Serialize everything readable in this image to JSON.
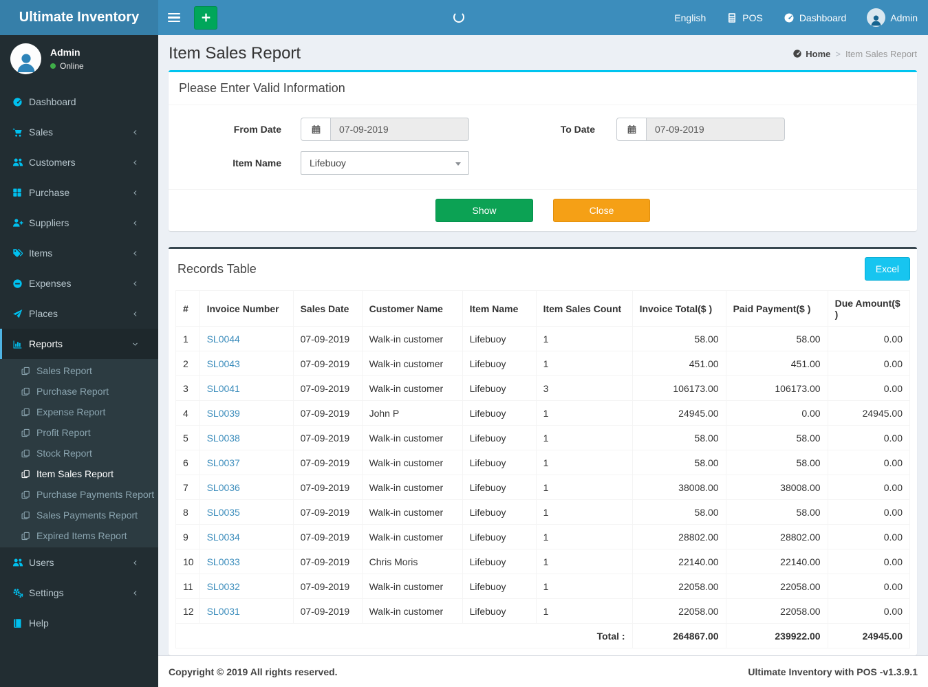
{
  "navbar": {
    "brand": "Ultimate Inventory",
    "language": "English",
    "pos_label": "POS",
    "dashboard_label": "Dashboard",
    "user_label": "Admin"
  },
  "sidebar": {
    "user": {
      "name": "Admin",
      "status": "Online"
    },
    "items": [
      {
        "label": "Dashboard",
        "icon": "speedometer-icon"
      },
      {
        "label": "Sales",
        "icon": "cart-icon"
      },
      {
        "label": "Customers",
        "icon": "users-icon"
      },
      {
        "label": "Purchase",
        "icon": "grid-icon"
      },
      {
        "label": "Suppliers",
        "icon": "user-plus-icon"
      },
      {
        "label": "Items",
        "icon": "tags-icon"
      },
      {
        "label": "Expenses",
        "icon": "minus-circle-icon"
      },
      {
        "label": "Places",
        "icon": "paper-plane-icon"
      },
      {
        "label": "Reports",
        "icon": "bar-chart-icon",
        "active": true,
        "expanded": true
      },
      {
        "label": "Users",
        "icon": "users-icon"
      },
      {
        "label": "Settings",
        "icon": "gears-icon"
      },
      {
        "label": "Help",
        "icon": "book-icon"
      }
    ],
    "reports_submenu": [
      {
        "label": "Sales Report",
        "icon": "copy-icon"
      },
      {
        "label": "Purchase Report",
        "icon": "copy-icon"
      },
      {
        "label": "Expense Report",
        "icon": "copy-icon"
      },
      {
        "label": "Profit Report",
        "icon": "copy-icon"
      },
      {
        "label": "Stock Report",
        "icon": "copy-icon"
      },
      {
        "label": "Item Sales Report",
        "icon": "copy-icon",
        "active": true
      },
      {
        "label": "Purchase Payments Report",
        "icon": "copy-icon"
      },
      {
        "label": "Sales Payments Report",
        "icon": "copy-icon"
      },
      {
        "label": "Expired Items Report",
        "icon": "copy-icon"
      }
    ]
  },
  "page": {
    "title": "Item Sales Report",
    "breadcrumb": {
      "home": "Home",
      "current": "Item Sales Report"
    }
  },
  "filter": {
    "header": "Please Enter Valid Information",
    "from_date": {
      "label": "From Date",
      "value": "07-09-2019"
    },
    "to_date": {
      "label": "To Date",
      "value": "07-09-2019"
    },
    "item_name": {
      "label": "Item Name",
      "value": "Lifebuoy"
    },
    "show_label": "Show",
    "close_label": "Close"
  },
  "records": {
    "header": "Records Table",
    "excel_label": "Excel",
    "columns": [
      "#",
      "Invoice Number",
      "Sales Date",
      "Customer Name",
      "Item Name",
      "Item Sales Count",
      "Invoice Total($ )",
      "Paid Payment($ )",
      "Due Amount($ )"
    ],
    "rows": [
      [
        "1",
        "SL0044",
        "07-09-2019",
        "Walk-in customer",
        "Lifebuoy",
        "1",
        "58.00",
        "58.00",
        "0.00"
      ],
      [
        "2",
        "SL0043",
        "07-09-2019",
        "Walk-in customer",
        "Lifebuoy",
        "1",
        "451.00",
        "451.00",
        "0.00"
      ],
      [
        "3",
        "SL0041",
        "07-09-2019",
        "Walk-in customer",
        "Lifebuoy",
        "3",
        "106173.00",
        "106173.00",
        "0.00"
      ],
      [
        "4",
        "SL0039",
        "07-09-2019",
        "John P",
        "Lifebuoy",
        "1",
        "24945.00",
        "0.00",
        "24945.00"
      ],
      [
        "5",
        "SL0038",
        "07-09-2019",
        "Walk-in customer",
        "Lifebuoy",
        "1",
        "58.00",
        "58.00",
        "0.00"
      ],
      [
        "6",
        "SL0037",
        "07-09-2019",
        "Walk-in customer",
        "Lifebuoy",
        "1",
        "58.00",
        "58.00",
        "0.00"
      ],
      [
        "7",
        "SL0036",
        "07-09-2019",
        "Walk-in customer",
        "Lifebuoy",
        "1",
        "38008.00",
        "38008.00",
        "0.00"
      ],
      [
        "8",
        "SL0035",
        "07-09-2019",
        "Walk-in customer",
        "Lifebuoy",
        "1",
        "58.00",
        "58.00",
        "0.00"
      ],
      [
        "9",
        "SL0034",
        "07-09-2019",
        "Walk-in customer",
        "Lifebuoy",
        "1",
        "28802.00",
        "28802.00",
        "0.00"
      ],
      [
        "10",
        "SL0033",
        "07-09-2019",
        "Chris Moris",
        "Lifebuoy",
        "1",
        "22140.00",
        "22140.00",
        "0.00"
      ],
      [
        "11",
        "SL0032",
        "07-09-2019",
        "Walk-in customer",
        "Lifebuoy",
        "1",
        "22058.00",
        "22058.00",
        "0.00"
      ],
      [
        "12",
        "SL0031",
        "07-09-2019",
        "Walk-in customer",
        "Lifebuoy",
        "1",
        "22058.00",
        "22058.00",
        "0.00"
      ]
    ],
    "total_label": "Total :",
    "totals": {
      "invoice_total": "264867.00",
      "paid_payment": "239922.00",
      "due_amount": "24945.00"
    }
  },
  "footer": {
    "left": "Copyright © 2019 All rights reserved.",
    "right": "Ultimate Inventory with POS -v1.3.9.1"
  },
  "colors": {
    "navbar": "#3c8dbc",
    "logo_bg": "#367fa9",
    "sidebar_bg": "#222d32",
    "submenu_bg": "#2c3b41",
    "sidebar_icon_accent": "#00c0ef",
    "success": "#00a65a",
    "warning": "#f39c12",
    "info": "#00c0ef",
    "link": "#3c8dbc",
    "filter_box_border": "#00c4ef",
    "records_box_border": "#37464f"
  }
}
